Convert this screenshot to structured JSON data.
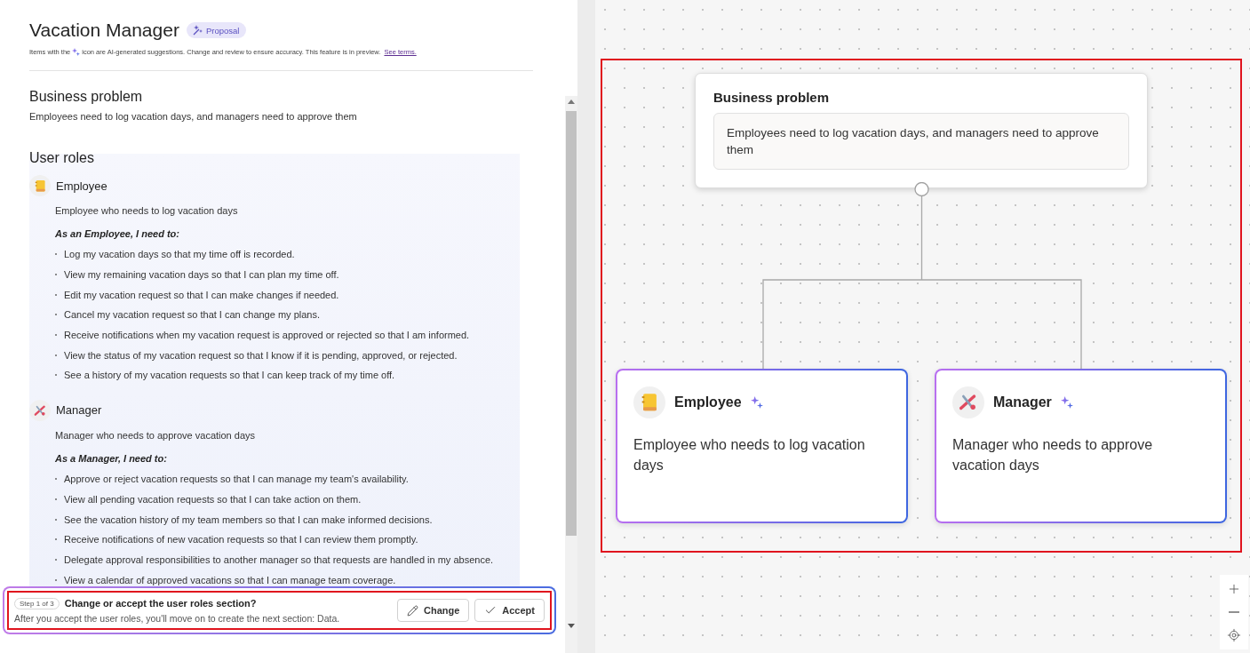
{
  "header": {
    "title": "Vacation Manager",
    "badge": "Proposal",
    "notice_before": "Items with the",
    "notice_after": "icon are AI-generated suggestions. Change and review to ensure accuracy. This feature is in preview.",
    "link": "See terms."
  },
  "business_problem": {
    "heading": "Business problem",
    "text": "Employees need to log vacation days, and managers need to approve them"
  },
  "user_roles": {
    "heading": "User roles",
    "roles": [
      {
        "name": "Employee",
        "kind": "notebook",
        "description": "Employee who needs to log vacation days",
        "needs_heading": "As an Employee, I need to:",
        "needs": [
          "Log my vacation days so that my time off is recorded.",
          "View my remaining vacation days so that I can plan my time off.",
          "Edit my vacation request so that I can make changes if needed.",
          "Cancel my vacation request so that I can change my plans.",
          "Receive notifications when my vacation request is approved or rejected so that I am informed.",
          "View the status of my vacation request so that I know if it is pending, approved, or rejected.",
          "See a history of my vacation requests so that I can keep track of my time off."
        ]
      },
      {
        "name": "Manager",
        "kind": "tools",
        "description": "Manager who needs to approve vacation days",
        "needs_heading": "As a Manager, I need to:",
        "needs": [
          "Approve or reject vacation requests so that I can manage my team's availability.",
          "View all pending vacation requests so that I can take action on them.",
          "See the vacation history of my team members so that I can make informed decisions.",
          "Receive notifications of new vacation requests so that I can review them promptly.",
          "Delegate approval responsibilities to another manager so that requests are handled in my absence.",
          "View a calendar of approved vacations so that I can manage team coverage."
        ]
      }
    ]
  },
  "step_bar": {
    "step": "Step 1 of 3",
    "question": "Change or accept the user roles section?",
    "detail": "After you accept the user roles, you'll move on to create the next section: Data.",
    "buttons": [
      {
        "label": "Change",
        "kind": "edit"
      },
      {
        "label": "Accept",
        "kind": "check"
      }
    ]
  },
  "canvas": {
    "problem_node": {
      "heading": "Business problem",
      "text": "Employees need to log vacation days, and managers need to approve them"
    },
    "role_cards": [
      {
        "name": "Employee",
        "kind": "notebook",
        "ai": true,
        "description": "Employee who needs to log vacation days"
      },
      {
        "name": "Manager",
        "kind": "tools",
        "ai": true,
        "description": "Manager who needs to approve vacation days"
      }
    ]
  }
}
